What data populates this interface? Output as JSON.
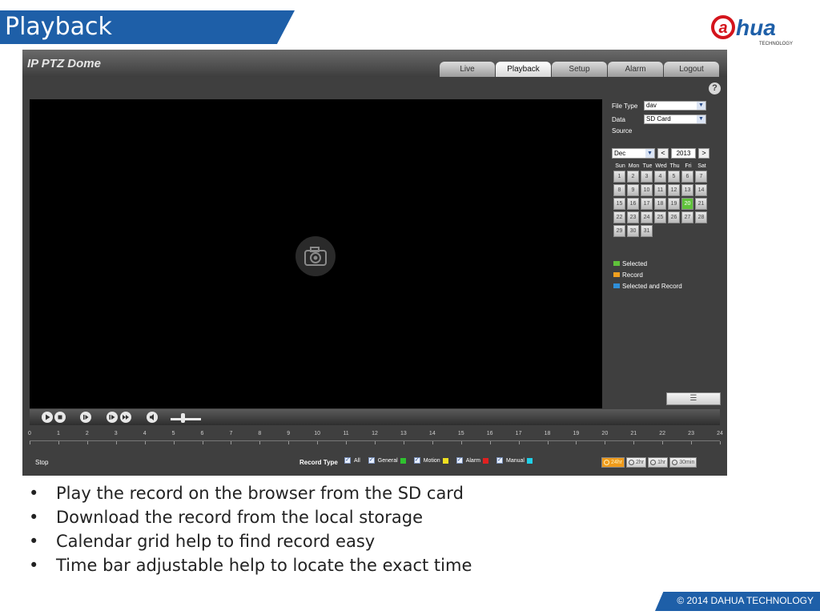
{
  "slide": {
    "title": "Playback",
    "logo": {
      "text_a": "a",
      "text_hua": "hua",
      "sub": "TECHNOLOGY"
    },
    "bullets": [
      "Play the record on the browser from the SD card",
      "Download the record from the local storage",
      "Calendar grid help to find record easy",
      "Time bar adjustable help to locate the exact time"
    ],
    "footer": "© 2014 DAHUA  TECHNOLOGY"
  },
  "ui": {
    "title": "IP PTZ Dome",
    "tabs": [
      "Live",
      "Playback",
      "Setup",
      "Alarm",
      "Logout"
    ],
    "active_tab": "Playback",
    "help": "?",
    "panel": {
      "file_type_label": "File Type",
      "file_type_value": "dav",
      "data_source_label_1": "Data",
      "data_source_label_2": "Source",
      "data_source_value": "SD Card",
      "month": "Dec",
      "year": "2013",
      "prev": "<",
      "next": ">",
      "weekdays": [
        "Sun",
        "Mon",
        "Tue",
        "Wed",
        "Thu",
        "Fri",
        "Sat"
      ],
      "days": [
        "1",
        "2",
        "3",
        "4",
        "5",
        "6",
        "7",
        "8",
        "9",
        "10",
        "11",
        "12",
        "13",
        "14",
        "15",
        "16",
        "17",
        "18",
        "19",
        "20",
        "21",
        "22",
        "23",
        "24",
        "25",
        "26",
        "27",
        "28",
        "29",
        "30",
        "31"
      ],
      "selected_day": "20",
      "legend": [
        {
          "label": "Selected",
          "color": "#5fc23a"
        },
        {
          "label": "Record",
          "color": "#f0a020"
        },
        {
          "label": "Selected and Record",
          "color": "#2f8fd8"
        }
      ]
    },
    "timeline_ticks": [
      "0",
      "1",
      "2",
      "3",
      "4",
      "5",
      "6",
      "7",
      "8",
      "9",
      "10",
      "11",
      "12",
      "13",
      "14",
      "15",
      "16",
      "17",
      "18",
      "19",
      "20",
      "21",
      "22",
      "23",
      "24"
    ],
    "status": "Stop",
    "record_type_label": "Record Type",
    "record_types": [
      {
        "label": "All",
        "color": ""
      },
      {
        "label": "General",
        "color": "#2fc22f"
      },
      {
        "label": "Motion",
        "color": "#f0e020"
      },
      {
        "label": "Alarm",
        "color": "#e02020"
      },
      {
        "label": "Manual",
        "color": "#20d0e8"
      }
    ],
    "zoom_options": [
      "24hr",
      "2hr",
      "1hr",
      "30min"
    ],
    "active_zoom": "24hr"
  }
}
